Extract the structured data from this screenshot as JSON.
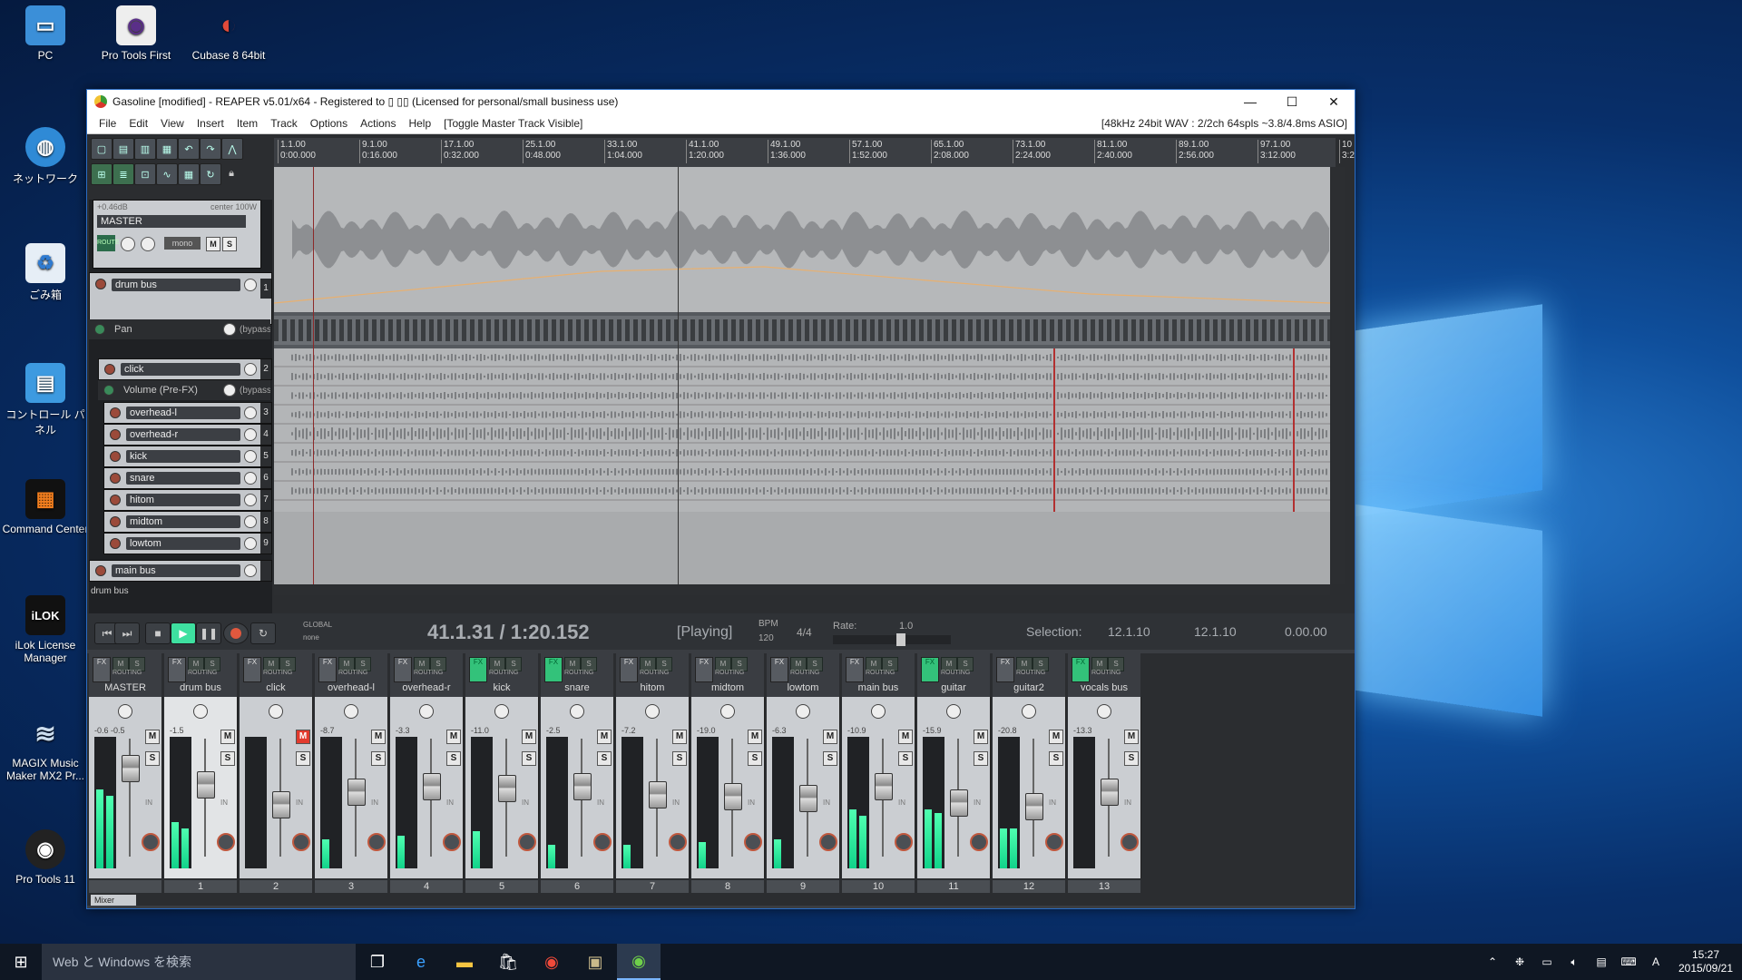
{
  "desktop": {
    "icons": [
      {
        "label": "PC",
        "icon": "computer-icon"
      },
      {
        "label": "Pro Tools First",
        "icon": "pro-tools-icon"
      },
      {
        "label": "Cubase 8 64bit",
        "icon": "cubase-icon"
      },
      {
        "label": "ネットワーク",
        "icon": "network-icon"
      },
      {
        "label": "ごみ箱",
        "icon": "recycle-bin-icon"
      },
      {
        "label": "コントロール パネル",
        "icon": "control-panel-icon"
      },
      {
        "label": "Command Center",
        "icon": "command-center-icon"
      },
      {
        "label": "iLok License Manager",
        "icon": "ilok-icon"
      },
      {
        "label": "MAGIX Music Maker MX2 Pr...",
        "icon": "magix-icon"
      },
      {
        "label": "Pro Tools 11",
        "icon": "pro-tools-icon"
      }
    ]
  },
  "window": {
    "title": "Gasoline [modified] - REAPER v5.01/x64 - Registered to ▯ ▯▯ (Licensed for personal/small business use)",
    "minimize": "—",
    "maximize": "☐",
    "close": "✕"
  },
  "menu": {
    "items": [
      "File",
      "Edit",
      "View",
      "Insert",
      "Item",
      "Track",
      "Options",
      "Actions",
      "Help",
      "[Toggle Master Track Visible]"
    ],
    "status": "[48kHz 24bit WAV : 2/2ch 64spls ~3.8/4.8ms ASIO]"
  },
  "ruler": {
    "marks": [
      {
        "bar": "1.1.00",
        "time": "0:00.000"
      },
      {
        "bar": "9.1.00",
        "time": "0:16.000"
      },
      {
        "bar": "17.1.00",
        "time": "0:32.000"
      },
      {
        "bar": "25.1.00",
        "time": "0:48.000"
      },
      {
        "bar": "33.1.00",
        "time": "1:04.000"
      },
      {
        "bar": "41.1.00",
        "time": "1:20.000"
      },
      {
        "bar": "49.1.00",
        "time": "1:36.000"
      },
      {
        "bar": "57.1.00",
        "time": "1:52.000"
      },
      {
        "bar": "65.1.00",
        "time": "2:08.000"
      },
      {
        "bar": "73.1.00",
        "time": "2:24.000"
      },
      {
        "bar": "81.1.00",
        "time": "2:40.000"
      },
      {
        "bar": "89.1.00",
        "time": "2:56.000"
      },
      {
        "bar": "97.1.00",
        "time": "3:12.000"
      },
      {
        "bar": "10",
        "time": "3:2"
      }
    ]
  },
  "master_tcp": {
    "volume": "+0.46dB",
    "pan": "center 100W",
    "name": "MASTER",
    "route": "ROUTE",
    "mono": "mono",
    "m": "M",
    "s": "S"
  },
  "tracks": [
    {
      "name": "drum bus",
      "num": "1"
    },
    {
      "name": "Pan",
      "num": "",
      "extra": "(bypass"
    },
    {
      "name": "click",
      "num": "2"
    },
    {
      "name": "Volume (Pre-FX)",
      "num": "",
      "extra": "(bypass"
    },
    {
      "name": "overhead-l",
      "num": "3"
    },
    {
      "name": "overhead-r",
      "num": "4"
    },
    {
      "name": "kick",
      "num": "5"
    },
    {
      "name": "snare",
      "num": "6"
    },
    {
      "name": "hitom",
      "num": "7"
    },
    {
      "name": "midtom",
      "num": "8"
    },
    {
      "name": "lowtom",
      "num": "9"
    },
    {
      "name": "main bus",
      "num": ""
    }
  ],
  "selected_track_label": "drum bus",
  "transport": {
    "position": "41.1.31 / 1:20.152",
    "state": "[Playing]",
    "bpm_label": "BPM",
    "bpm": "120",
    "timesig": "4/4",
    "rate_label": "Rate:",
    "rate": "1.0",
    "selection_label": "Selection:",
    "sel_start": "12.1.10",
    "sel_end": "12.1.10",
    "sel_len": "0.00.00",
    "global": "GLOBAL",
    "none": "none"
  },
  "mixer": {
    "tab_label": "Mixer",
    "strips": [
      {
        "name": "MASTER",
        "num": "",
        "fx": false,
        "vol": "-0.6   -0.5",
        "fader": 0.78,
        "meter": [
          0.6,
          0.55
        ]
      },
      {
        "name": "drum bus",
        "num": "1",
        "fx": false,
        "vol": "-1.5",
        "fader": 0.62,
        "meter": [
          0.35,
          0.3
        ]
      },
      {
        "name": "click",
        "num": "2",
        "fx": false,
        "vol": "",
        "fader": 0.42,
        "meter": [
          0,
          0
        ],
        "muted": true
      },
      {
        "name": "overhead-l",
        "num": "3",
        "fx": false,
        "vol": "-8.7",
        "fader": 0.55,
        "meter": [
          0.22,
          0
        ]
      },
      {
        "name": "overhead-r",
        "num": "4",
        "fx": false,
        "vol": "-3.3",
        "fader": 0.6,
        "meter": [
          0.25,
          0
        ]
      },
      {
        "name": "kick",
        "num": "5",
        "fx": true,
        "vol": "-11.0",
        "fader": 0.58,
        "meter": [
          0.28,
          0
        ]
      },
      {
        "name": "snare",
        "num": "6",
        "fx": true,
        "vol": "-2.5",
        "fader": 0.6,
        "meter": [
          0.18,
          0
        ]
      },
      {
        "name": "hitom",
        "num": "7",
        "fx": false,
        "vol": "-7.2",
        "fader": 0.52,
        "meter": [
          0.18,
          0
        ]
      },
      {
        "name": "midtom",
        "num": "8",
        "fx": false,
        "vol": "-19.0",
        "fader": 0.5,
        "meter": [
          0.2,
          0
        ]
      },
      {
        "name": "lowtom",
        "num": "9",
        "fx": false,
        "vol": "-6.3",
        "fader": 0.48,
        "meter": [
          0.22,
          0
        ]
      },
      {
        "name": "main bus",
        "num": "10",
        "fx": false,
        "vol": "-10.9",
        "fader": 0.6,
        "meter": [
          0.45,
          0.4
        ]
      },
      {
        "name": "guitar",
        "num": "11",
        "fx": true,
        "vol": "-15.9",
        "fader": 0.44,
        "meter": [
          0.45,
          0.42
        ]
      },
      {
        "name": "guitar2",
        "num": "12",
        "fx": false,
        "vol": "-20.8",
        "fader": 0.4,
        "meter": [
          0.3,
          0.3
        ]
      },
      {
        "name": "vocals bus",
        "num": "13",
        "fx": true,
        "vol": "-13.3",
        "fader": 0.55,
        "meter": [
          0,
          0
        ]
      }
    ],
    "fx_label": "FX",
    "routing_label": "ROUTING",
    "m": "M",
    "s": "S",
    "in": "IN",
    "mono": "MONO"
  },
  "taskbar": {
    "search": "Web と Windows を検索",
    "ime": "A",
    "time": "15:27",
    "date": "2015/09/21"
  }
}
